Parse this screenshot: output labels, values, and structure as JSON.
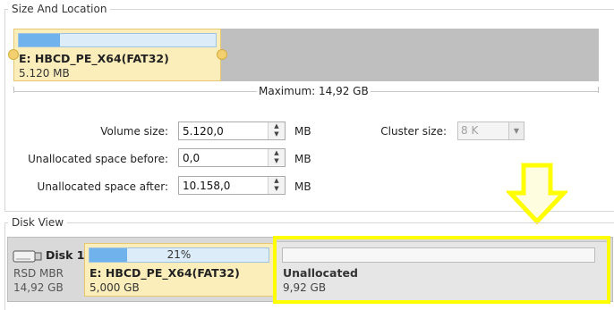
{
  "size_and_location": {
    "title": "Size And Location",
    "partition": {
      "name": "E: HBCD_PE_X64(FAT32)",
      "size": "5.120 MB",
      "usage_fraction": 0.21
    },
    "maximum_label": "Maximum: 14,92 GB"
  },
  "fields": {
    "volume_size": {
      "label": "Volume size:",
      "value": "5.120,0",
      "unit": "MB"
    },
    "unallocated_before": {
      "label": "Unallocated space before:",
      "value": "0,0",
      "unit": "MB"
    },
    "unallocated_after": {
      "label": "Unallocated space after:",
      "value": "10.158,0",
      "unit": "MB"
    },
    "cluster_size": {
      "label": "Cluster size:",
      "value": "8 K"
    }
  },
  "disk_view": {
    "title": "Disk View",
    "disk": {
      "name": "Disk 1",
      "type": "RSD MBR",
      "size": "14,92 GB"
    },
    "partition": {
      "usage_percent": "21%",
      "usage_fraction": 0.21,
      "name": "E: HBCD_PE_X64(FAT32)",
      "size": "5,000 GB"
    },
    "unallocated": {
      "label": "Unallocated",
      "size": "9,92 GB"
    }
  },
  "colors": {
    "highlight": "#ffff00",
    "partition_fill": "#fbeebb",
    "usage_fill": "#6fb2ec",
    "free_space": "#bfbfbf"
  },
  "icons": {
    "spin_up": "▲",
    "spin_down": "▼",
    "dropdown": "▼",
    "disk": "usb-drive-icon",
    "annotation": "down-arrow-icon"
  }
}
